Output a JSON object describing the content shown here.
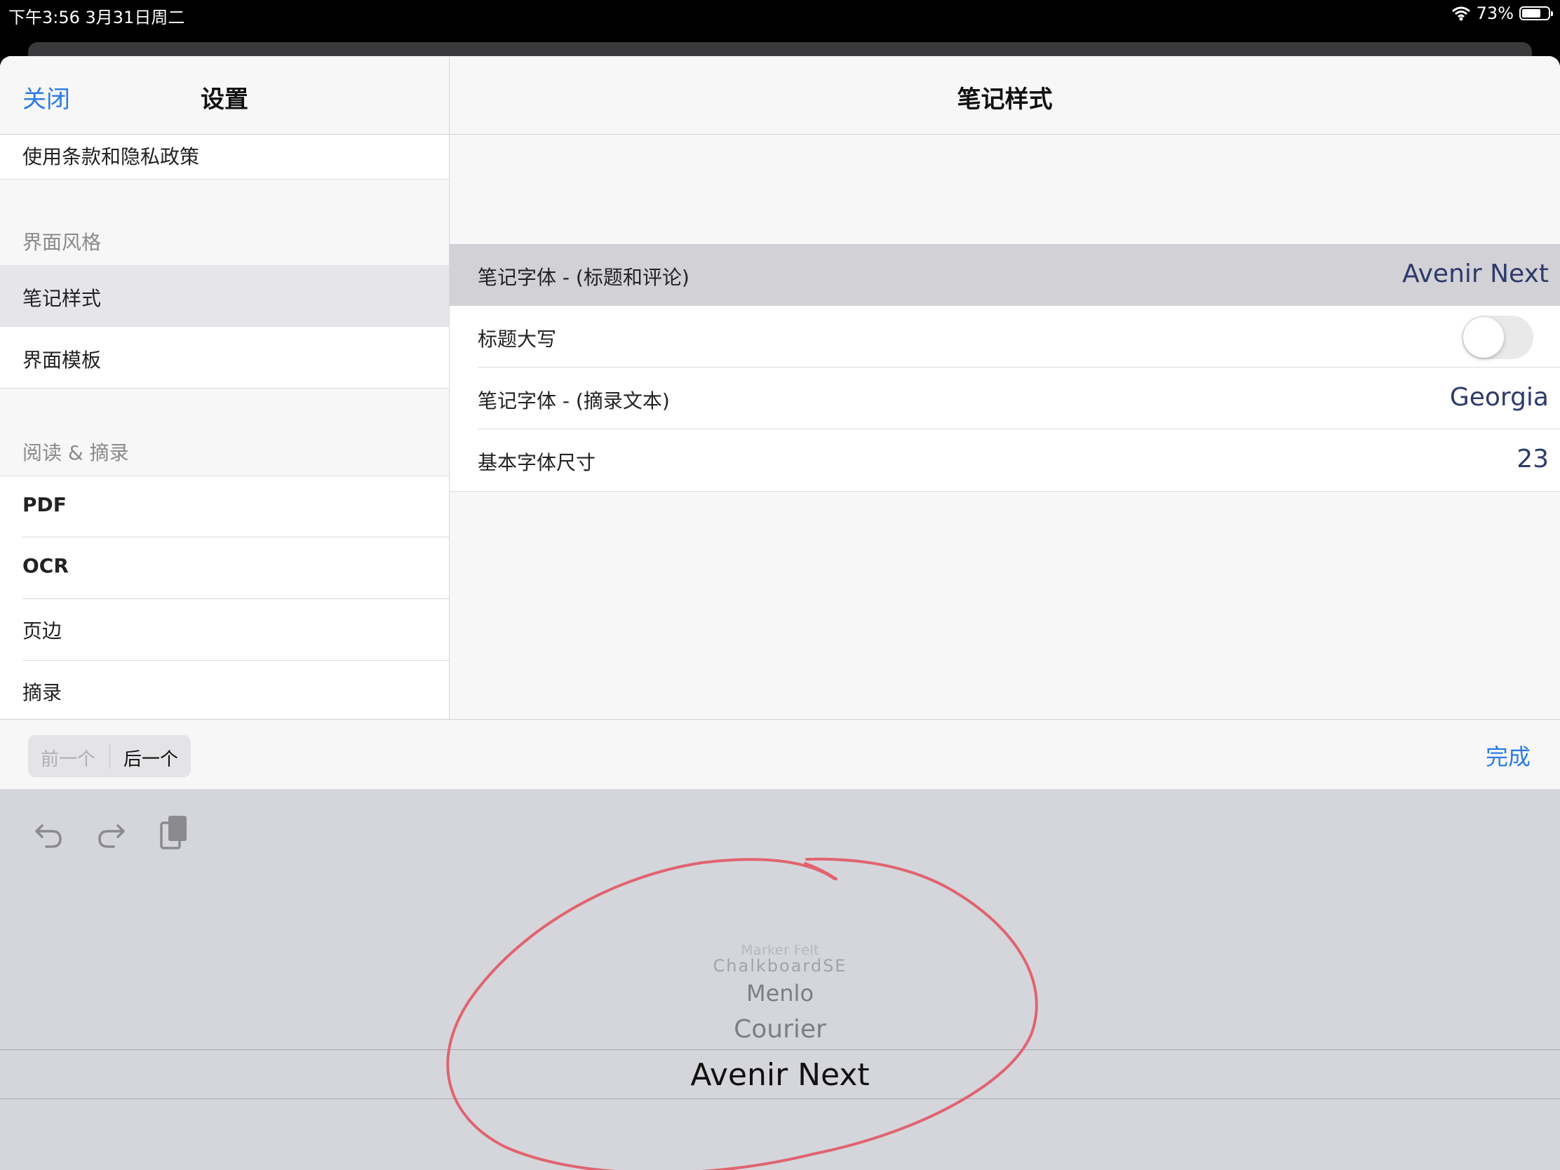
{
  "status_bar": {
    "time_date": "下午3:56   3月31日周二",
    "battery_percent": "73%",
    "battery_level": 0.73
  },
  "left_panel": {
    "close_label": "关闭",
    "title": "设置",
    "top_item": "使用条款和隐私政策",
    "sections": [
      {
        "header": "界面风格",
        "items": [
          "笔记样式",
          "界面模板"
        ]
      },
      {
        "header": "阅读 & 摘录",
        "items": [
          "PDF",
          "OCR",
          "页边",
          "摘录"
        ]
      }
    ]
  },
  "right_panel": {
    "title": "笔记样式",
    "rows": [
      {
        "label": "笔记字体 - (标题和评论)",
        "value": "Avenir Next"
      },
      {
        "label": "标题大写",
        "toggle_on": false
      },
      {
        "label": "笔记字体 - (摘录文本)",
        "value": "Georgia"
      },
      {
        "label": "基本字体尺寸",
        "value": "23"
      }
    ]
  },
  "accessory_bar": {
    "prev_label": "前一个",
    "next_label": "后一个",
    "done_label": "完成"
  },
  "toolbar_icons": [
    "undo-icon",
    "redo-icon",
    "paste-icon"
  ],
  "picker": {
    "items": [
      "Marker Felt",
      "ChalkboardSE",
      "Menlo",
      "Courier",
      "Avenir Next"
    ],
    "selected": "Avenir Next"
  },
  "colors": {
    "accent": "#2c7be5",
    "value_text": "#2e3a6b",
    "annotation": "#e06470",
    "selected_row": "#d1d1d6"
  }
}
